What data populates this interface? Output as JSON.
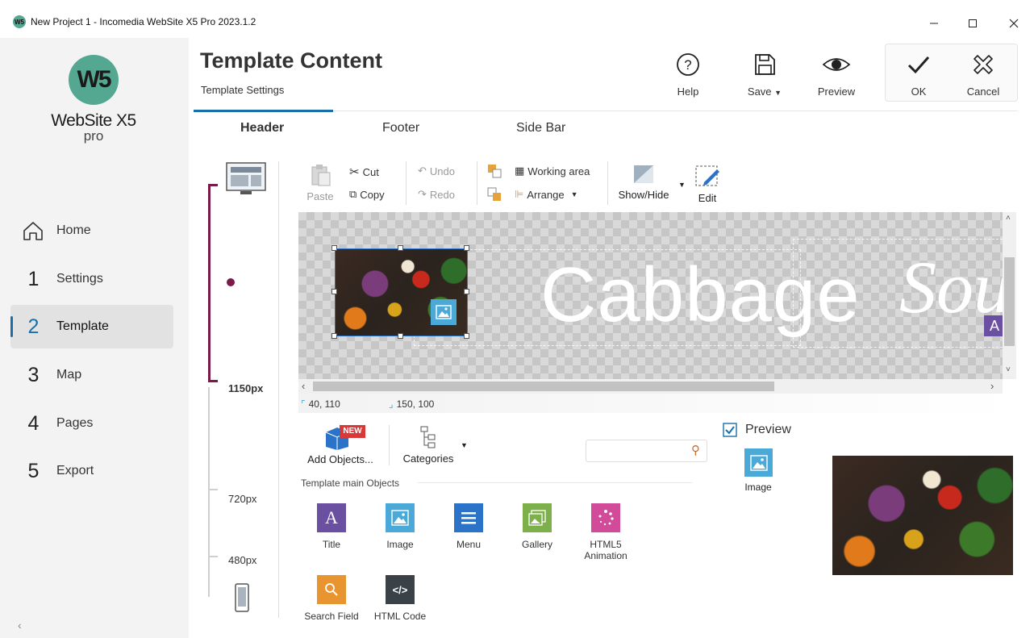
{
  "window": {
    "title": "New Project 1 - Incomedia WebSite X5 Pro 2023.1.2",
    "minimize_icon": "minimize-icon",
    "maximize_icon": "maximize-icon",
    "close_icon": "close-icon"
  },
  "brand": {
    "logo_text": "W5",
    "name": "WebSite X5",
    "edition": "pro",
    "color": "#54a790"
  },
  "nav": [
    {
      "num": "",
      "label": "Home",
      "icon": "home-icon"
    },
    {
      "num": "1",
      "label": "Settings"
    },
    {
      "num": "2",
      "label": "Template",
      "active": true
    },
    {
      "num": "3",
      "label": "Map"
    },
    {
      "num": "4",
      "label": "Pages"
    },
    {
      "num": "5",
      "label": "Export"
    }
  ],
  "header": {
    "title": "Template Content",
    "subtitle": "Template Settings",
    "help": "Help",
    "save": "Save",
    "preview": "Preview",
    "ok": "OK",
    "cancel": "Cancel"
  },
  "tabs": [
    "Header",
    "Footer",
    "Side Bar"
  ],
  "editor_toolbar": {
    "paste": "Paste",
    "cut": "Cut",
    "copy": "Copy",
    "undo": "Undo",
    "redo": "Redo",
    "working_area": "Working area",
    "arrange": "Arrange",
    "show_hide": "Show/Hide",
    "edit": "Edit"
  },
  "canvas": {
    "text_main": "Cabbage",
    "text_script": "Sou",
    "position": "40, 110",
    "size": "150, 100"
  },
  "breakpoints": {
    "desktop": "1150px",
    "tablet": "720px",
    "phone": "480px"
  },
  "objects_panel": {
    "add_objects": "Add Objects...",
    "new_badge": "NEW",
    "categories": "Categories",
    "search_placeholder": "",
    "section_title": "Template main Objects",
    "items": [
      {
        "label": "Title",
        "color": "#6b4fa0",
        "icon": "title-icon"
      },
      {
        "label": "Image",
        "color": "#4aa9d6",
        "icon": "image-icon"
      },
      {
        "label": "Menu",
        "color": "#2a73c9",
        "icon": "menu-icon"
      },
      {
        "label": "Gallery",
        "color": "#7db04a",
        "icon": "gallery-icon"
      },
      {
        "label": "HTML5 Animation",
        "color": "#d24a9a",
        "icon": "animation-icon"
      },
      {
        "label": "Search Field",
        "color": "#e89430",
        "icon": "search-icon"
      },
      {
        "label": "HTML Code",
        "color": "#3a4248",
        "icon": "code-icon"
      }
    ]
  },
  "preview_panel": {
    "checkbox_label": "Preview",
    "checked": true,
    "selected_object": "Image"
  },
  "colors": {
    "accent": "#1b6fa8",
    "breakpoint_bracket": "#7a1a4a"
  }
}
